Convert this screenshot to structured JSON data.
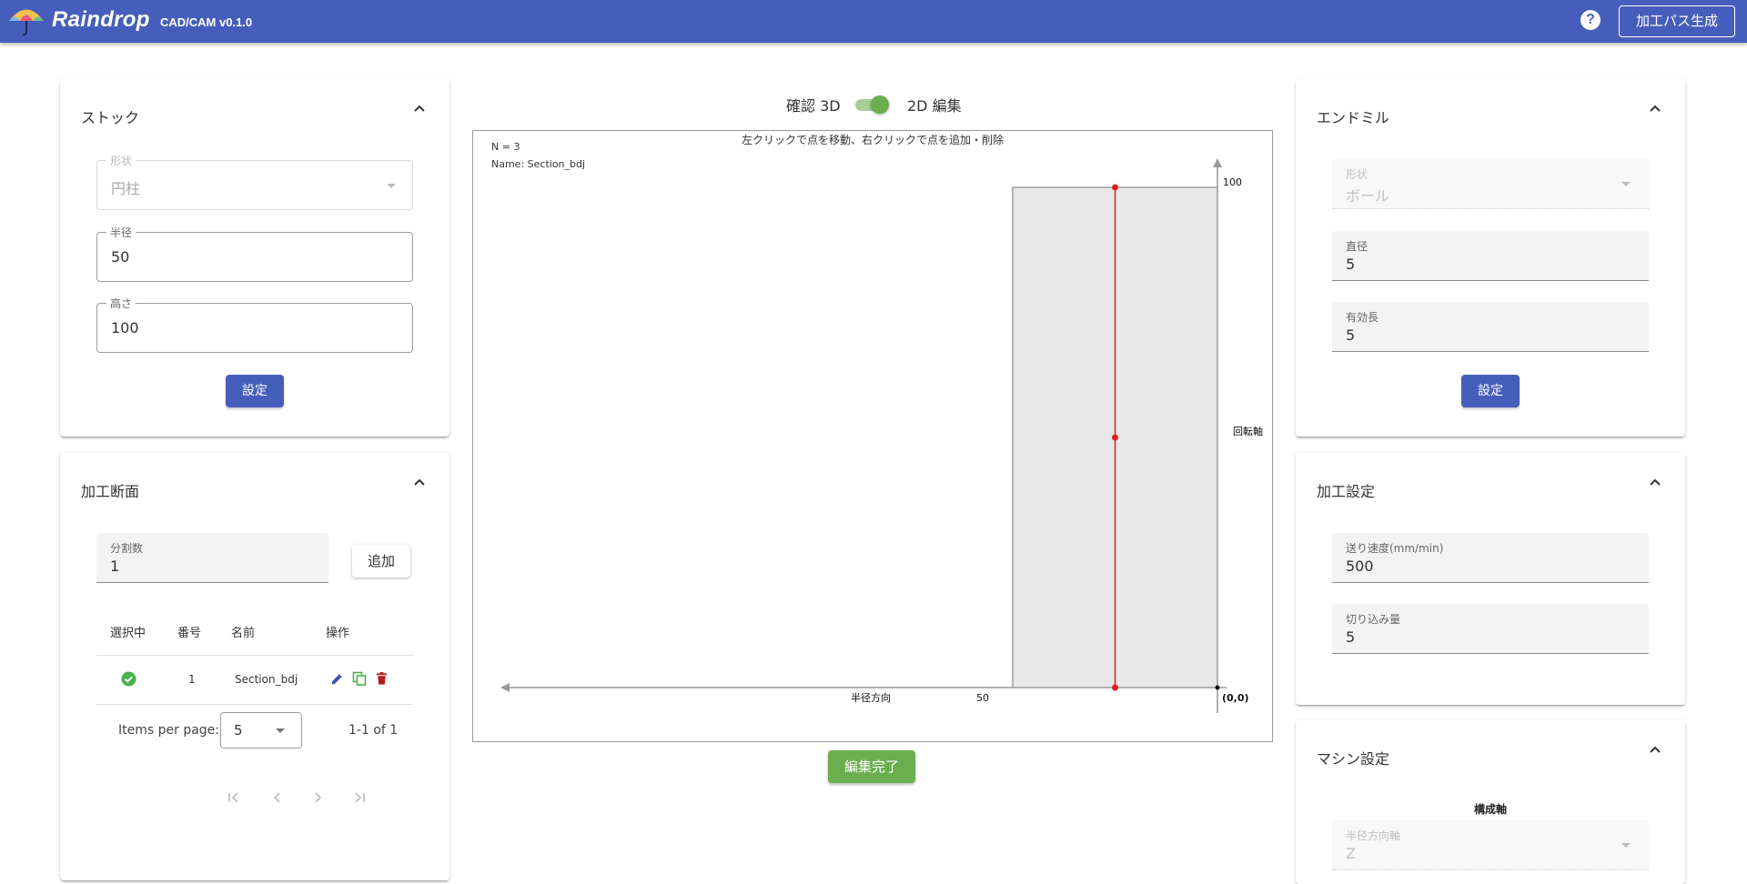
{
  "header": {
    "brand": "Raindrop",
    "version": "CAD/CAM v0.1.0",
    "help_glyph": "?",
    "generate_button": "加工パス生成",
    "background_color": "#465ebb"
  },
  "stock": {
    "title": "ストック",
    "shape": {
      "label": "形状",
      "value": "円柱"
    },
    "radius": {
      "label": "半径",
      "value": "50"
    },
    "height": {
      "label": "高さ",
      "value": "100"
    },
    "set_button": "設定"
  },
  "section": {
    "title": "加工断面",
    "divisions": {
      "label": "分割数",
      "value": "1"
    },
    "add_button": "追加",
    "columns": [
      "選択中",
      "番号",
      "名前",
      "操作"
    ],
    "rows": [
      {
        "selected_icon": "check-circle-icon",
        "number": "1",
        "name": "Section_bdj",
        "actions": [
          "edit-icon",
          "copy-icon",
          "delete-icon"
        ]
      }
    ],
    "items_per_page_label": "Items per page:",
    "items_per_page_value": "5",
    "range": "1-1 of 1"
  },
  "center": {
    "toggle_left": "確認 3D",
    "toggle_right": "2D 編集",
    "toggle_on": true,
    "finish_button": "編集完了",
    "finish_color": "#6aae4e"
  },
  "plot": {
    "n_label": "N = 3",
    "name_label": "Name: Section_bdj",
    "instruction": "左クリックで点を移動、右クリックで点を追加・削除",
    "radial_axis_label": "半径方向",
    "rotation_axis_label": "回転軸",
    "origin_label": "(0,0)",
    "radius_tick": "50",
    "height_tick": "100",
    "stock_radius": 50,
    "stock_height": 100,
    "profile_points": [
      {
        "r": 25,
        "z": 0
      },
      {
        "r": 25,
        "z": 50
      },
      {
        "r": 25,
        "z": 100
      }
    ],
    "profile_color": "#e0201c"
  },
  "endmill": {
    "title": "エンドミル",
    "shape": {
      "label": "形状",
      "value": "ボール"
    },
    "diameter": {
      "label": "直径",
      "value": "5"
    },
    "effective_length": {
      "label": "有効長",
      "value": "5"
    },
    "set_button": "設定"
  },
  "machining": {
    "title": "加工設定",
    "feed": {
      "label": "送り速度(mm/min)",
      "value": "500"
    },
    "depth": {
      "label": "切り込み量",
      "value": "5"
    }
  },
  "machine": {
    "title": "マシン設定",
    "config_axis_label": "構成軸",
    "radial_axis": {
      "label": "半径方向軸",
      "value": "Z"
    }
  }
}
